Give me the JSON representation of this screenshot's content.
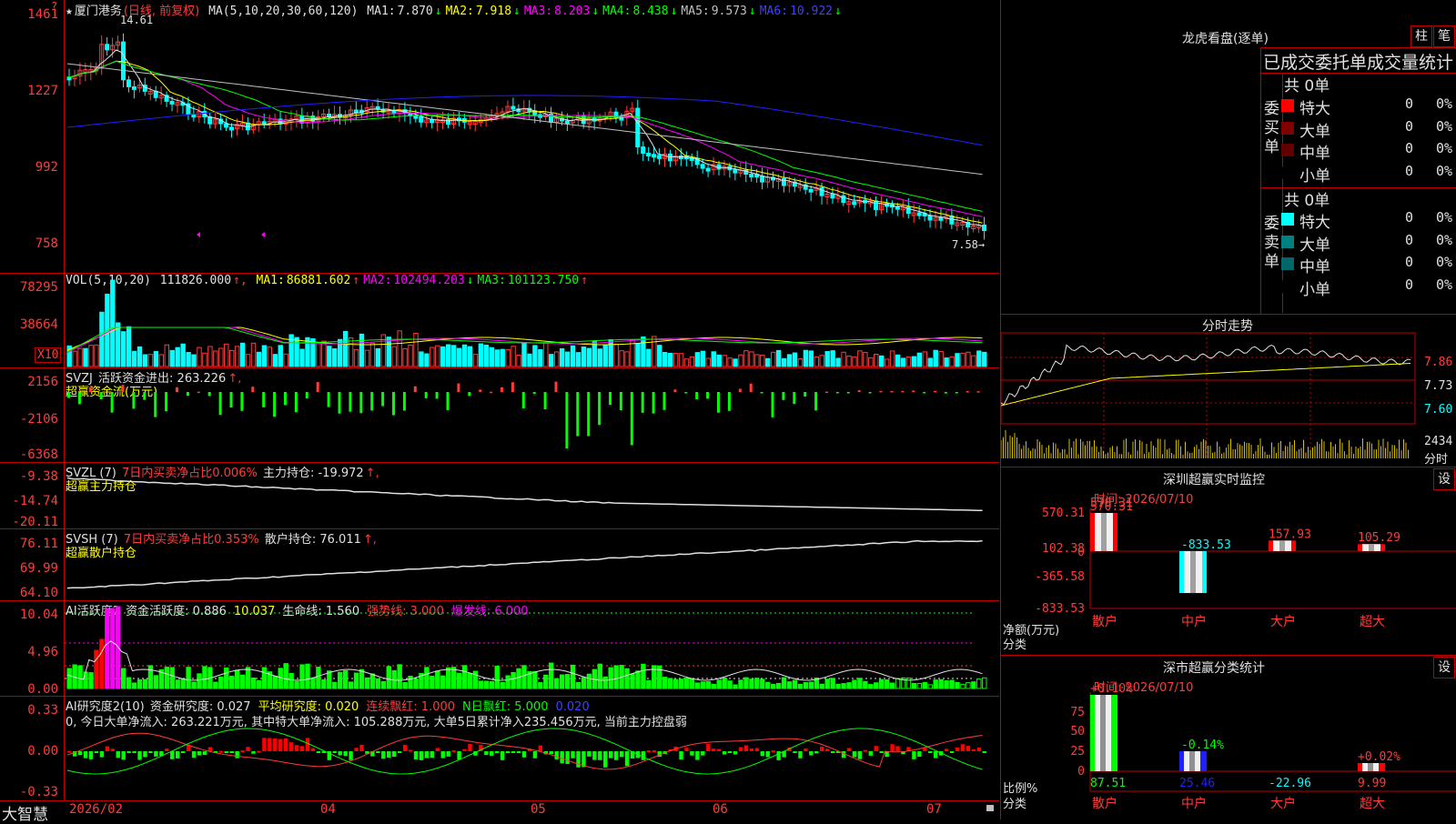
{
  "app": {
    "brand": "大智慧",
    "corner_marker": "?"
  },
  "main": {
    "stock_name": "厦门港务",
    "mode": "(日线, 前复权)",
    "ma_title": "MA(5,10,20,30,60,120)",
    "ma": [
      {
        "label": "MA1:",
        "value": "7.870",
        "arrow": "↓",
        "color": "#e0e0e0"
      },
      {
        "label": "MA2:",
        "value": "7.918",
        "arrow": "↓",
        "color": "#ffff00"
      },
      {
        "label": "MA3:",
        "value": "8.203",
        "arrow": "↓",
        "color": "#ff00ff"
      },
      {
        "label": "MA4:",
        "value": "8.438",
        "arrow": "↓",
        "color": "#00ff00"
      },
      {
        "label": "MA5:",
        "value": "9.573",
        "arrow": "↓",
        "color": "#c0c0c0"
      },
      {
        "label": "MA6:",
        "value": "10.922",
        "arrow": "↓",
        "color": "#4040ff"
      }
    ],
    "y_ticks": [
      "1461",
      "1227",
      "992",
      "758"
    ],
    "high_label": "14.61",
    "last_label": "7.58→"
  },
  "vol": {
    "title": "VOL(5,10,20)",
    "value": "111826.000",
    "ma": [
      {
        "label": "MA1:",
        "value": "86881.602",
        "arrow": "↑",
        "color": "#ffff00"
      },
      {
        "label": "MA2:",
        "value": "102494.203",
        "arrow": "↓",
        "color": "#ff00ff"
      },
      {
        "label": "MA3:",
        "value": "101123.750",
        "arrow": "↑",
        "color": "#00ff00"
      }
    ],
    "y_ticks": [
      "78295",
      "38664"
    ],
    "unit": "X10"
  },
  "svzj": {
    "title": "SVZJ",
    "desc": "活跃资金进出: 263.226",
    "sub": "超赢资金流(万元)",
    "y_ticks": [
      "2156",
      "-2106",
      "-6368"
    ]
  },
  "svzl": {
    "title": "SVZL (7)",
    "ratio": "7日内买卖净占比0.006%",
    "holding": "主力持仓: -19.972",
    "sub": "超赢主力持仓",
    "y_ticks": [
      "-9.38",
      "-14.74",
      "-20.11"
    ]
  },
  "svsh": {
    "title": "SVSH (7)",
    "ratio": "7日内买卖净占比0.353%",
    "holding": "散户持仓: 76.011",
    "sub": "超赢散户持仓",
    "y_ticks": [
      "76.11",
      "69.99",
      "64.10"
    ]
  },
  "ai_active": {
    "title": "AI活跃度2",
    "items": [
      {
        "text": "资金活跃度: 0.886",
        "color": "#e0e0e0"
      },
      {
        "text": "10.037",
        "color": "#ffff00"
      },
      {
        "text": "生命线: 1.560",
        "color": "#e0e0e0"
      },
      {
        "text": "强势线: 3.000",
        "color": "#ff3b3b"
      },
      {
        "text": "爆发线: 6.000",
        "color": "#ff00ff"
      }
    ],
    "y_ticks": [
      "10.04",
      "4.96",
      "0.00"
    ]
  },
  "ai_research": {
    "title": "AI研究度2(10)",
    "items": [
      {
        "text": "资金研究度: 0.027",
        "color": "#e0e0e0"
      },
      {
        "text": "平均研究度: 0.020",
        "color": "#ffff00"
      },
      {
        "text": "连续飘红: 1.000",
        "color": "#ff3b3b"
      },
      {
        "text": "N日飘红: 5.000",
        "color": "#00ff00"
      },
      {
        "text": "0.020",
        "color": "#4040ff"
      }
    ],
    "note": "0, 今日大单净流入: 263.221万元, 其中特大单净流入: 105.288万元, 大单5日累计净入235.456万元, 当前主力控盘弱",
    "y_ticks": [
      "0.33",
      "0.00",
      "-0.33"
    ]
  },
  "x_axis": [
    "2026/02",
    "04",
    "05",
    "06",
    "07"
  ],
  "right_panel": {
    "dragon_title": "龙虎看盘(逐单)",
    "btn_zhu": "柱",
    "btn_bi": "笔",
    "stats_title": "已成交委托单成交量统计",
    "buy_label": "委买单",
    "sell_label": "委卖单",
    "buy_total": "共 0单",
    "sell_total": "共 0单",
    "buy_rows": [
      {
        "name": "特大",
        "count": "0",
        "pct": "0%",
        "color": "#ff0000"
      },
      {
        "name": "大单",
        "count": "0",
        "pct": "0%",
        "color": "#800000"
      },
      {
        "name": "中单",
        "count": "0",
        "pct": "0%",
        "color": "#600000"
      },
      {
        "name": "小单",
        "count": "0",
        "pct": "0%",
        "color": "#000000"
      }
    ],
    "sell_rows": [
      {
        "name": "特大",
        "count": "0",
        "pct": "0%",
        "color": "#00ffff"
      },
      {
        "name": "大单",
        "count": "0",
        "pct": "0%",
        "color": "#008080"
      },
      {
        "name": "中单",
        "count": "0",
        "pct": "0%",
        "color": "#006868"
      },
      {
        "name": "小单",
        "count": "0",
        "pct": "0%",
        "color": "#000000"
      }
    ],
    "intraday_title": "分时走势",
    "intraday_ticks": [
      "7.86",
      "7.73",
      "7.60"
    ],
    "intraday_vol": "2434",
    "intraday_unit": "分时",
    "sz_title": "深圳超赢实时监控",
    "sz_date": "时间: 2026/07/10",
    "sz_btn": "设",
    "sz_ticks": [
      "570.31",
      "102.38",
      "0",
      "-365.58",
      "-833.53"
    ],
    "sz_y_label": "净额(万元)",
    "sz_x_label": "分类",
    "sz_cats": [
      "散户",
      "中户",
      "大户",
      "超大"
    ],
    "sz_values": [
      "570.31",
      "-833.53",
      "157.93",
      "105.29"
    ],
    "cls_title": "深市超赢分类统计",
    "cls_date": "时间: 2026/07/10",
    "cls_btn": "设",
    "cls_ticks": [
      "75",
      "50",
      "25",
      "0"
    ],
    "cls_y_label": "比例%",
    "cls_x_label": "分类",
    "cls_cats": [
      "散户",
      "中户",
      "大户",
      "超大"
    ],
    "cls_top": [
      "+0.10%",
      "-0.14%",
      "",
      "+0.02%"
    ],
    "cls_bottom": [
      "87.51",
      "25.46",
      "-22.96",
      "9.99"
    ]
  },
  "chart_data": [
    {
      "type": "candlestick",
      "title": "厦门港务 (日线, 前复权)",
      "y_ticks": [
        1461,
        1227,
        992,
        758
      ],
      "high": 14.61,
      "last": 7.58,
      "ma": {
        "MA1": 7.87,
        "MA2": 7.918,
        "MA3": 8.203,
        "MA4": 8.438,
        "MA5": 9.573,
        "MA6": 10.922
      }
    },
    {
      "type": "bar",
      "title": "VOL(5,10,20)",
      "value": 111826.0,
      "ma": {
        "MA1": 86881.602,
        "MA2": 102494.203,
        "MA3": 101123.75
      }
    },
    {
      "type": "bar",
      "title": "SVZJ",
      "value": 263.226
    },
    {
      "type": "line",
      "title": "SVZL (7)",
      "value": -19.972
    },
    {
      "type": "line",
      "title": "SVSH (7)",
      "value": 76.011
    },
    {
      "type": "bar",
      "title": "AI活跃度2",
      "value": 0.886
    },
    {
      "type": "bar",
      "title": "AI研究度2(10)",
      "value": 0.027
    },
    {
      "type": "bar",
      "title": "深圳超赢实时监控",
      "categories": [
        "散户",
        "中户",
        "大户",
        "超大"
      ],
      "values": [
        570.31,
        -833.53,
        157.93,
        105.29
      ]
    },
    {
      "type": "bar",
      "title": "深市超赢分类统计",
      "categories": [
        "散户",
        "中户",
        "大户",
        "超大"
      ],
      "values": [
        87.51,
        25.46,
        -22.96,
        9.99
      ]
    }
  ]
}
